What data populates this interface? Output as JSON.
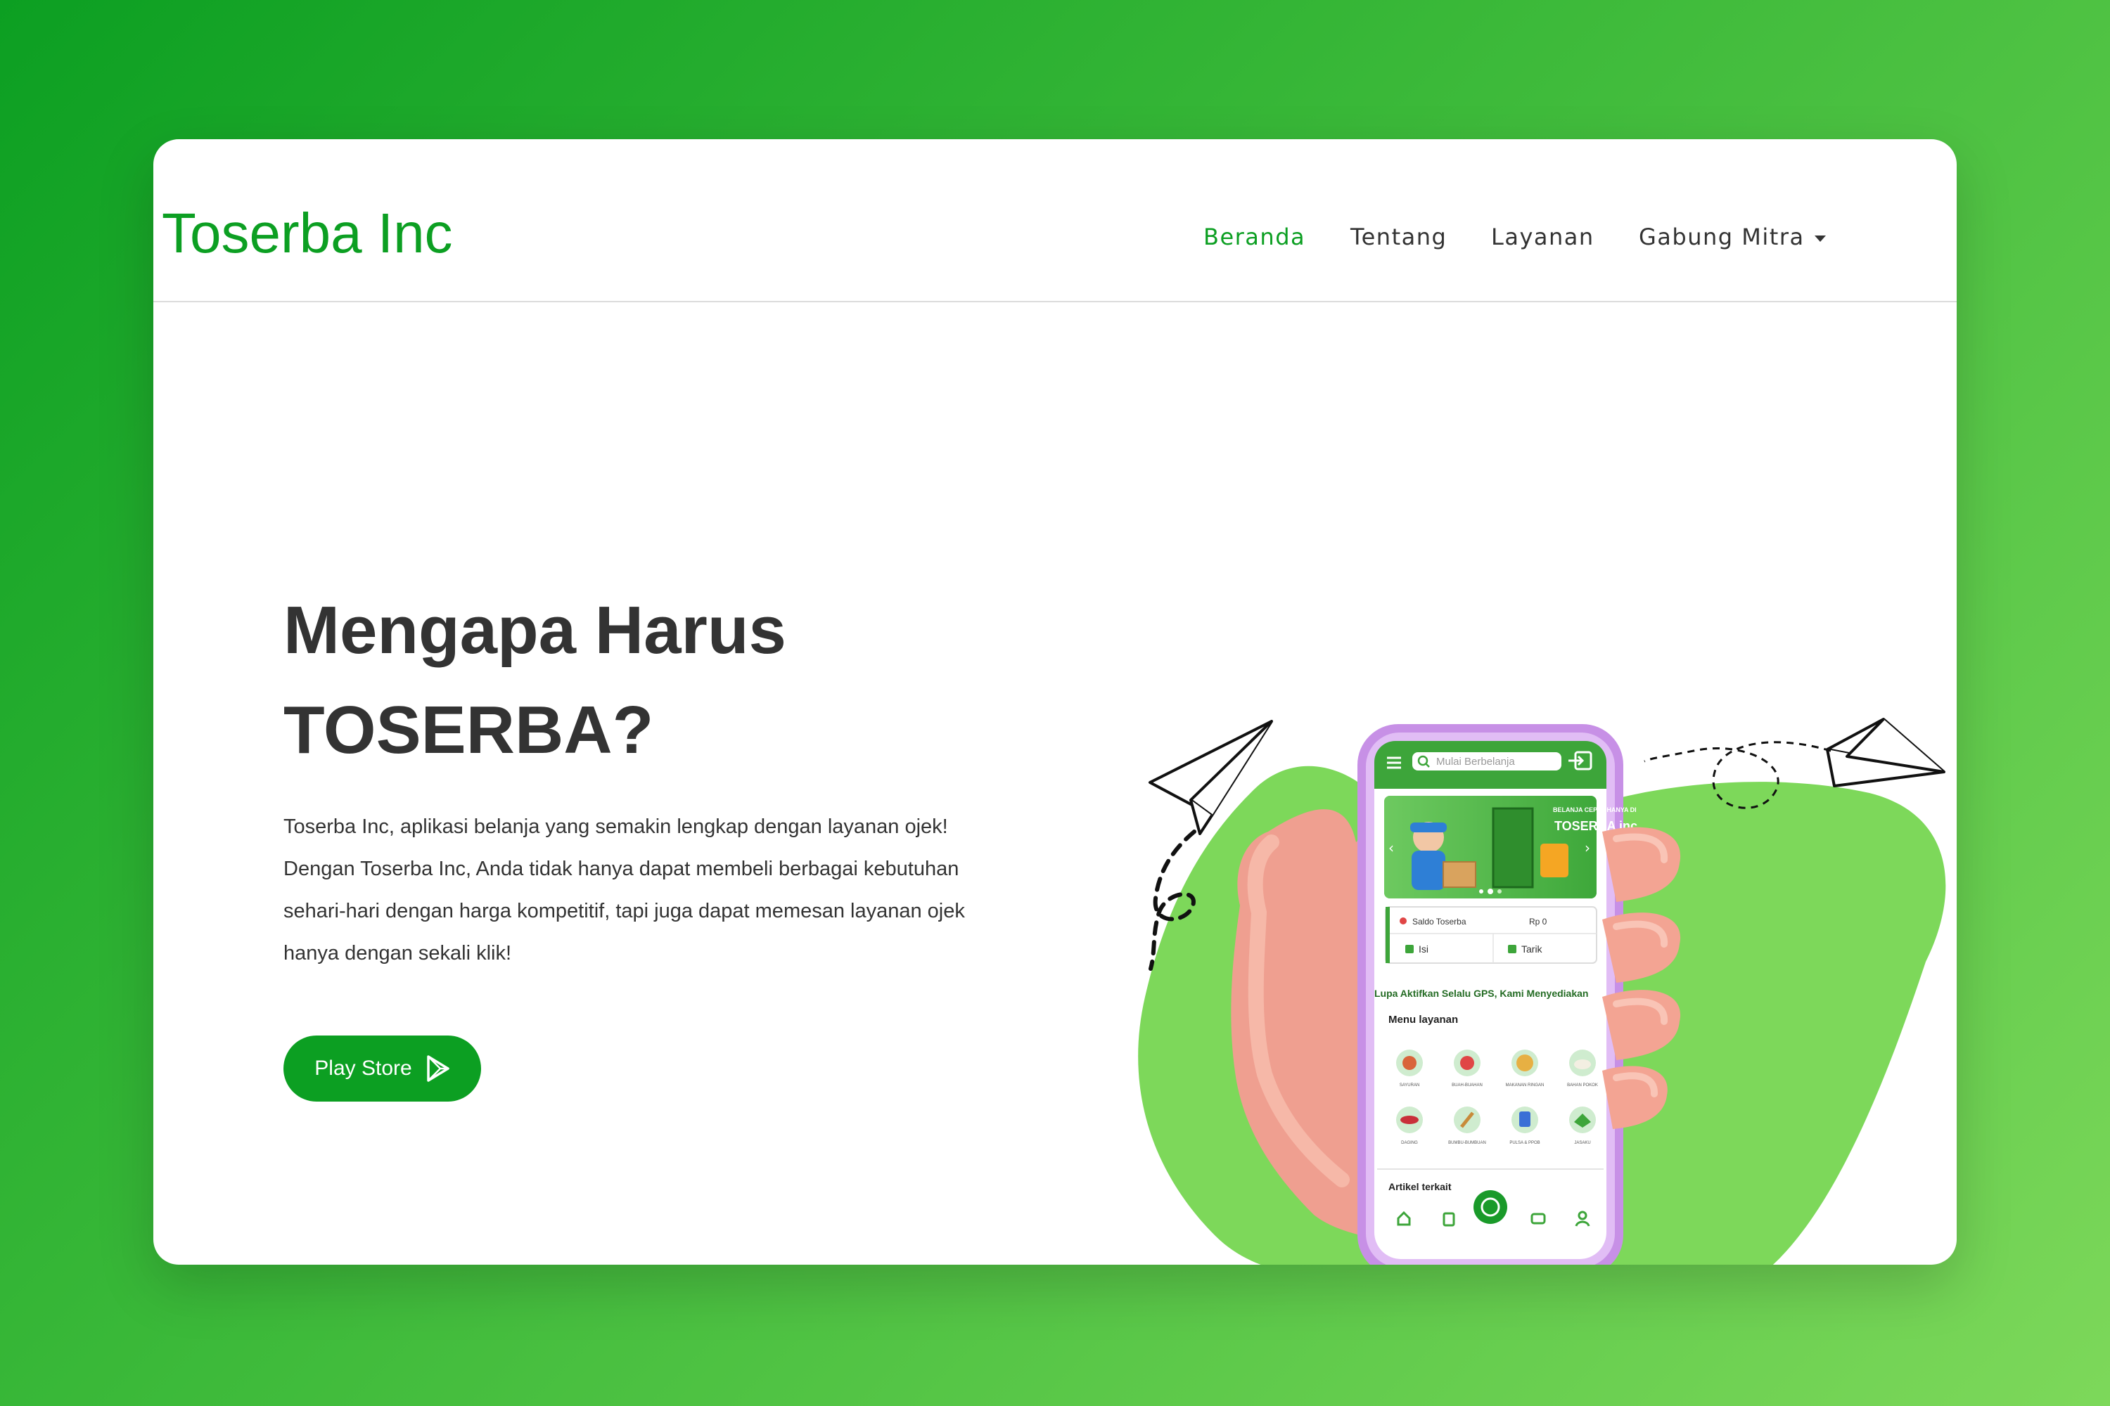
{
  "brand": {
    "name": "Toserba Inc"
  },
  "nav": {
    "items": [
      {
        "label": "Beranda",
        "active": true
      },
      {
        "label": "Tentang"
      },
      {
        "label": "Layanan"
      },
      {
        "label": "Gabung Mitra"
      }
    ]
  },
  "hero": {
    "title_line1": "Mengapa Harus",
    "title_line2": "TOSERBA?",
    "description_lines": [
      "Toserba Inc, aplikasi belanja yang semakin lengkap dengan layanan ojek!",
      "Dengan Toserba Inc, Anda tidak hanya dapat membeli berbagai kebutuhan",
      "sehari-hari dengan harga kompetitif, tapi juga dapat memesan layanan ojek",
      "hanya dengan sekali klik!"
    ],
    "cta_label": "Play Store"
  },
  "phone": {
    "search_placeholder": "Mulai Berbelanja",
    "banner_line1": "BELANJA CEPAT HANYA DI",
    "banner_line2": "TOSERBA inc",
    "saldo_label": "Saldo Toserba",
    "saldo_value": "Rp 0",
    "isi_label": "Isi",
    "tarik_label": "Tarik",
    "ticker": "Lupa Aktifkan Selalu GPS, Kami Menyediakan",
    "menu_title": "Menu layanan",
    "menu_items": [
      "SAYURAN",
      "BUAH-BUAHAN",
      "MAKANAN RINGAN",
      "BAHAN POKOK",
      "DAGING",
      "BUMBU-BUMBUAN",
      "PULSA & PPOB",
      "JASAKU"
    ],
    "article_title": "Artikel terkait"
  },
  "colors": {
    "primary": "#0c9f22",
    "blob": "#7dd85a",
    "phone_frame": "#d6a8ee"
  }
}
